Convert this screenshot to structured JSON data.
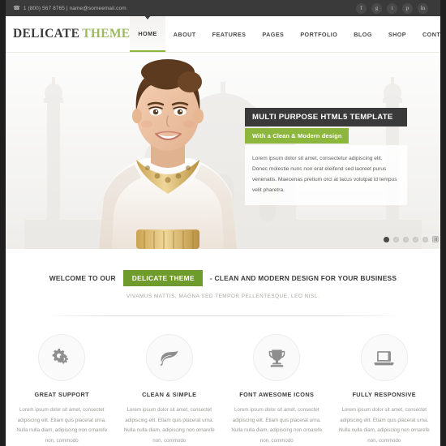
{
  "topbar": {
    "phone_icon": "phone-icon",
    "contact": "1 (800) 567 8765  |  name@someemail.com",
    "social": [
      {
        "name": "facebook-icon",
        "glyph": "f"
      },
      {
        "name": "google-plus-icon",
        "glyph": "g"
      },
      {
        "name": "twitter-icon",
        "glyph": "t"
      },
      {
        "name": "pinterest-icon",
        "glyph": "p"
      },
      {
        "name": "linkedin-icon",
        "glyph": "in"
      }
    ]
  },
  "header": {
    "logo_primary": "DELICATE",
    "logo_secondary": "THEME",
    "nav": [
      {
        "label": "HOME",
        "active": true
      },
      {
        "label": "ABOUT",
        "active": false
      },
      {
        "label": "FEATURES",
        "active": false
      },
      {
        "label": "PAGES",
        "active": false
      },
      {
        "label": "PORTFOLIO",
        "active": false
      },
      {
        "label": "BLOG",
        "active": false
      },
      {
        "label": "SHOP",
        "active": false
      },
      {
        "label": "CONTACT",
        "active": false
      }
    ]
  },
  "hero": {
    "caption_title": "MULTI PURPOSE HTML5 TEMPLATE",
    "caption_subtitle": "With a Clean & Modern design",
    "caption_body": "Lorem ipsum dolor sit amet, consectetur adipiscing elit. Donec molestie nunc non erat eleifend sed laoreet purus venenatis. Maecenas pretium orci at lacus volutpat id tempus velit pharetra.",
    "slide_count": 5,
    "active_slide": 1,
    "pause_control": "pause-icon"
  },
  "welcome": {
    "pre": "WELCOME TO OUR",
    "highlight": "DELICATE THEME",
    "post": "- CLEAN AND MODERN DESIGN FOR YOUR BUSINESS",
    "subtitle": "VIVAMUS MATTIS, MAGNA SED TEMPOR PELLENTESQUE, LEO NISL."
  },
  "features": [
    {
      "icon": "gears-icon",
      "title": "GREAT SUPPORT",
      "text": "Lorem ipsum dolor sit amet, consectet adipiscing elit. Etiam quis placerat urna. Nulla nulla diam, adipiscing non ornarefe non, commodo"
    },
    {
      "icon": "leaf-icon",
      "title": "CLEAN & SIMPLE",
      "text": "Lorem ipsum dolor sit amet, consectet adipiscing elit. Etiam quis placerat urna. Nulla nulla diam, adipiscing non ornarefe non, commodo"
    },
    {
      "icon": "trophy-icon",
      "title": "FONT AWESOME ICONS",
      "text": "Lorem ipsum dolor sit amet, consectet adipiscing elit. Etiam quis placerat urna. Nulla nulla diam, adipiscing non ornarefe non, commodo"
    },
    {
      "icon": "laptop-icon",
      "title": "FULLY RESPONSIVE",
      "text": "Lorem ipsum dolor sit amet, consectet adipiscing elit. Etiam quis placerat urna. Nulla nulla diam, adipiscing non ornarefe non, commodo"
    }
  ],
  "colors": {
    "accent_green": "#8cb63c",
    "pill_green": "#6f9a2c",
    "dark": "#3a3a3a",
    "topbar": "#3a3a3a"
  }
}
